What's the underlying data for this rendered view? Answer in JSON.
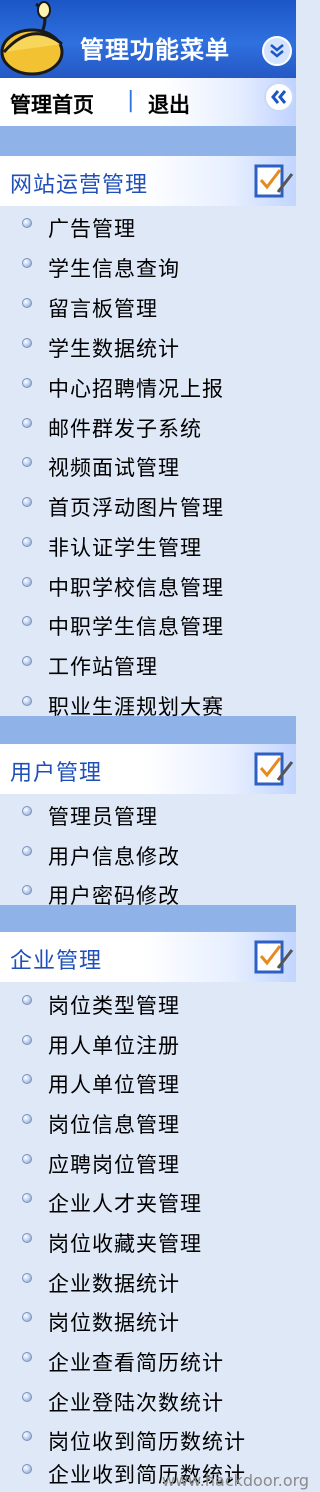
{
  "header": {
    "title": "管理功能菜单",
    "logo_icon": "helmet-logo-icon",
    "collapse_icon": "double-chevron-down-icon"
  },
  "nav": {
    "home": "管理首页",
    "separator": "|",
    "logout": "退出",
    "hide_icon": "double-chevron-left-icon"
  },
  "sections": [
    {
      "title": "网站运营管理",
      "items": [
        "广告管理",
        "学生信息查询",
        "留言板管理",
        "学生数据统计",
        "中心招聘情况上报",
        "邮件群发子系统",
        "视频面试管理",
        "首页浮动图片管理",
        "非认证学生管理",
        "中职学校信息管理",
        "中职学生信息管理",
        "工作站管理",
        "职业生涯规划大赛"
      ]
    },
    {
      "title": "用户管理",
      "items": [
        "管理员管理",
        "用户信息修改",
        "用户密码修改"
      ]
    },
    {
      "title": "企业管理",
      "items": [
        "岗位类型管理",
        "用人单位注册",
        "用人单位管理",
        "岗位信息管理",
        "应聘岗位管理",
        "企业人才夹管理",
        "岗位收藏夹管理",
        "企业数据统计",
        "岗位数据统计",
        "企业查看简历统计",
        "企业登陆次数统计",
        "岗位收到简历数统计",
        "企业收到简历数统计"
      ]
    }
  ],
  "watermark": "www.hackdoor.org",
  "colors": {
    "header_blue": "#2f70df",
    "section_title": "#1f4fb8",
    "gap_blue": "#8fb2e8"
  }
}
